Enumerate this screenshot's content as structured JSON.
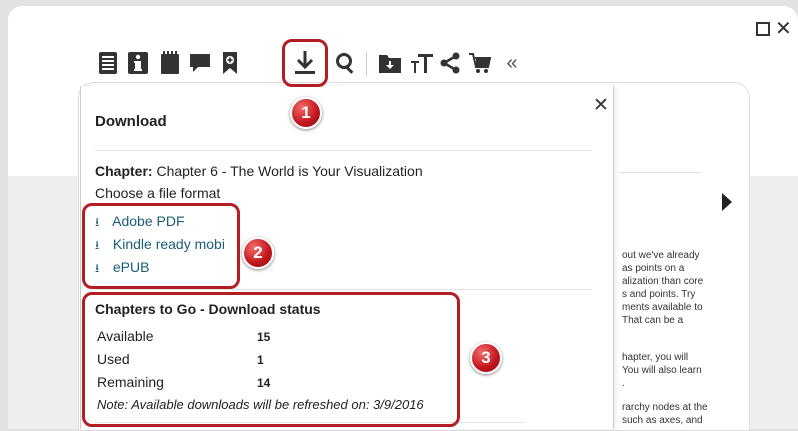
{
  "toolbar": {
    "icons": [
      "toc-icon",
      "info-icon",
      "notes-icon",
      "comments-icon",
      "bookmark-add-icon",
      "download-icon",
      "search-icon",
      "folder-download-icon",
      "text-size-icon",
      "share-icon",
      "cart-icon",
      "collapse-icon"
    ],
    "collapse_label": "«"
  },
  "window": {
    "close_label": "✕"
  },
  "popup": {
    "title": "Download",
    "close_label": "✕",
    "chapter_label": "Chapter:",
    "chapter_value": "Chapter 6 - The World is Your Visualization",
    "choose_label": "Choose a file format",
    "download_glyph": "⭳",
    "formats": [
      "Adobe PDF",
      "Kindle ready mobi",
      "ePUB"
    ],
    "status_title": "Chapters to Go - Download status",
    "status": [
      {
        "label": "Available",
        "value": "15"
      },
      {
        "label": "Used",
        "value": "1"
      },
      {
        "label": "Remaining",
        "value": "14"
      }
    ],
    "note": "Note: Available downloads will be refreshed on: 3/9/2016"
  },
  "callouts": [
    "1",
    "2",
    "3"
  ],
  "background_text": [
    "out we've already",
    " as points on a",
    "alization than core",
    "s and points. Try",
    "ments available to",
    " That can be a",
    "hapter, you will",
    " You will also learn",
    ".",
    "rarchy nodes at the",
    "such as axes, and"
  ],
  "colors": {
    "callout": "#b31d24",
    "link": "#1b5c78"
  }
}
